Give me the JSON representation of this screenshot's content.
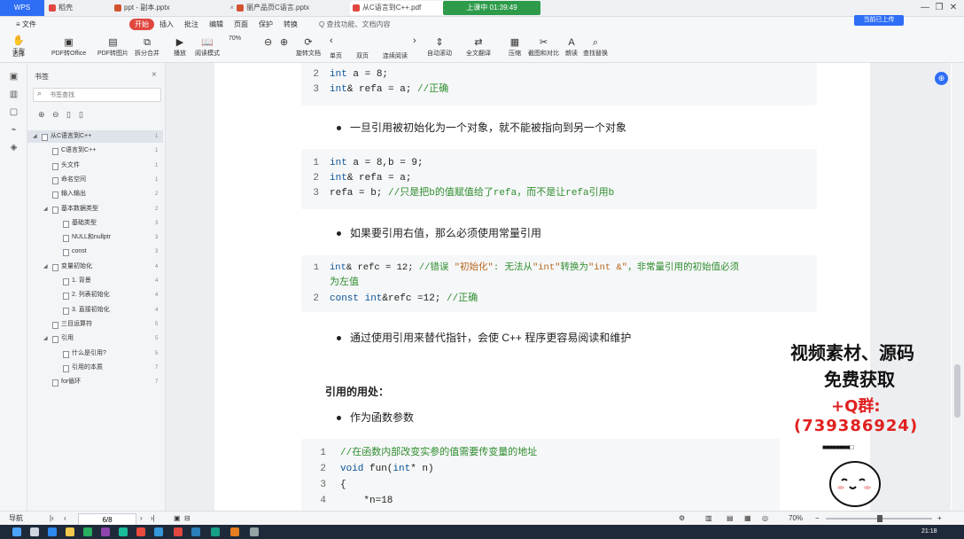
{
  "titlebar": {
    "app_label": "WPS",
    "tabs": [
      {
        "label": "稻壳",
        "color": "#e0473f"
      },
      {
        "label": "ppt - 副本.pptx",
        "color": "#d35230"
      },
      {
        "label": "丽产品页C语言.pptx",
        "color": "#d35230"
      },
      {
        "label": "从C语言到C++.pdf",
        "color": "#e0473f"
      }
    ],
    "recording": "上课中 01:39:49",
    "controls": [
      "—",
      "❐",
      "✕"
    ]
  },
  "menubar": {
    "items": [
      "≡ 文件",
      "开始",
      "插入",
      "批注",
      "编辑",
      "页面",
      "保护",
      "转换"
    ],
    "search": "Q 查找功能、文档内容",
    "cloud_button": "当前已上传"
  },
  "ribbon": {
    "page_value": "6/8",
    "buttons": [
      "手型",
      "选择",
      "PDF转Office",
      "PDF转图片",
      "拆分合并",
      "播放",
      "阅读模式",
      "旋转文档",
      "单页",
      "双页",
      "连续阅读",
      "自动滚动",
      "全文翻译",
      "压缩",
      "截图和对比",
      "朗读",
      "查找替换"
    ],
    "zoom": "70%"
  },
  "sidebar": {
    "title": "书签",
    "search_placeholder": "书签查找",
    "items": [
      {
        "label": "从C语言到C++",
        "level": 0,
        "page": "1",
        "selected": true
      },
      {
        "label": "C语言到C++",
        "level": 1,
        "page": "1"
      },
      {
        "label": "头文件",
        "level": 1,
        "page": "1"
      },
      {
        "label": "命名空间",
        "level": 1,
        "page": "1"
      },
      {
        "label": "输入输出",
        "level": 1,
        "page": "2"
      },
      {
        "label": "基本数据类型",
        "level": 1,
        "page": "2"
      },
      {
        "label": "基础类型",
        "level": 2,
        "page": "3"
      },
      {
        "label": "NULL和nullptr",
        "level": 2,
        "page": "3"
      },
      {
        "label": "const",
        "level": 2,
        "page": "3"
      },
      {
        "label": "变量初始化",
        "level": 1,
        "page": "4"
      },
      {
        "label": "1. 背景",
        "level": 2,
        "page": "4"
      },
      {
        "label": "2. 列表初始化",
        "level": 2,
        "page": "4"
      },
      {
        "label": "3. 直接初始化",
        "level": 2,
        "page": "4"
      },
      {
        "label": "三目运算符",
        "level": 1,
        "page": "5"
      },
      {
        "label": "引用",
        "level": 1,
        "page": "5"
      },
      {
        "label": "什么是引用?",
        "level": 2,
        "page": "5"
      },
      {
        "label": "引用的本质",
        "level": 2,
        "page": "7"
      },
      {
        "label": "for循环",
        "level": 1,
        "page": "7"
      }
    ]
  },
  "document": {
    "block1": [
      {
        "num": "2",
        "code": "int a = 8;"
      },
      {
        "num": "3",
        "code": "int& refa = a;  //正确"
      }
    ],
    "bullet1": "一旦引用被初始化为一个对象，就不能被指向到另一个对象",
    "block2": [
      {
        "num": "1",
        "code": "int a = 8,b = 9;"
      },
      {
        "num": "2",
        "code": "int& refa = a;"
      },
      {
        "num": "3",
        "code": "refa = b;        //只是把b的值赋值给了refa，而不是让refa引用b"
      }
    ],
    "bullet2": "如果要引用右值，那么必须使用常量引用",
    "block3": [
      {
        "num": "1",
        "code": "int& refc = 12;     //错误 \"初始化\": 无法从\"int\"转换为\"int &\"，非常量引用的初始值必须"
      },
      {
        "num": "",
        "code": "为左值"
      },
      {
        "num": "2",
        "code": "const int&refc =12; //正确"
      }
    ],
    "bullet3": "通过使用引用来替代指针，会使 C++ 程序更容易阅读和维护",
    "heading": "引用的用处：",
    "bullet4": "作为函数参数",
    "block4": [
      {
        "num": "1",
        "code": "//在函数内部改变实参的值需要传变量的地址"
      },
      {
        "num": "2",
        "code": "void fun(int* n)"
      },
      {
        "num": "3",
        "code": "{"
      },
      {
        "num": "4",
        "code": "    *n=18"
      }
    ]
  },
  "promo": {
    "line1": "视频素材、源码",
    "line2": "免费获取",
    "line3": "+Q群:",
    "line4": "(739386924)",
    "color_main": "#111111",
    "color_accent": "#e02020"
  },
  "statusbar": {
    "nav_label": "导航",
    "page": "6/8",
    "zoom": "70%"
  },
  "taskbar": {
    "clock": "21:18"
  }
}
